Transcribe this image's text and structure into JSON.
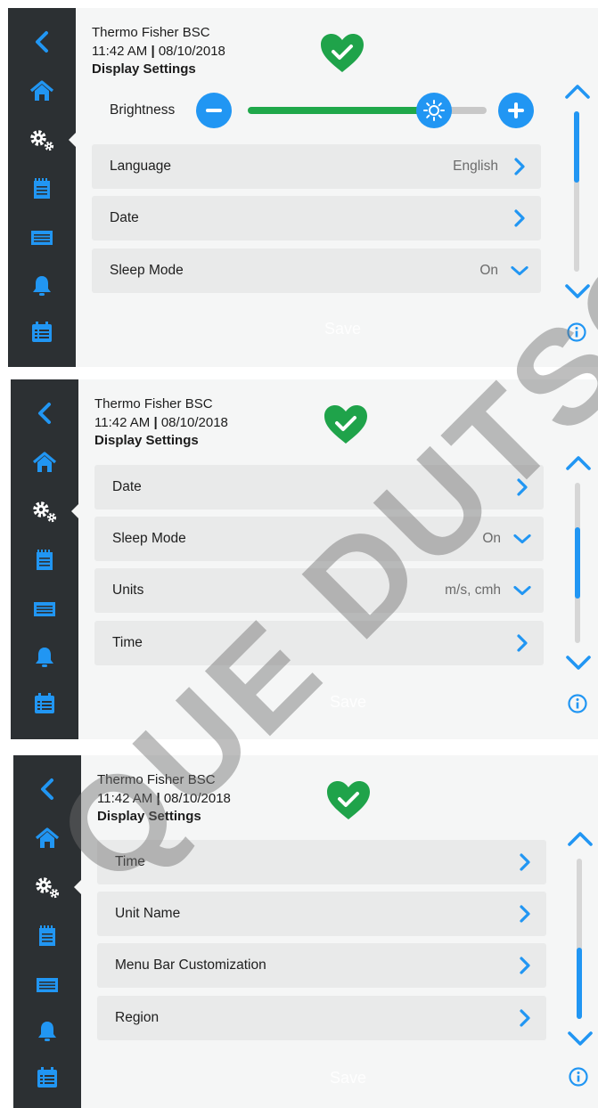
{
  "screens": [
    {
      "header": {
        "device": "Thermo Fisher BSC",
        "time": "11:42  AM",
        "separator": "|",
        "date": "08/10/2018",
        "page_title": "Display Settings"
      },
      "brightness": {
        "label": "Brightness",
        "level": 0.78
      },
      "rows": [
        {
          "label": "Language",
          "value": "English",
          "icon": "chevron-right-icon"
        },
        {
          "label": "Date",
          "value": "",
          "icon": "chevron-right-icon"
        },
        {
          "label": "Sleep Mode",
          "value": "On",
          "icon": "chevron-down-icon"
        }
      ],
      "save_label": "Save",
      "scroll_position": 0.0
    },
    {
      "header": {
        "device": "Thermo Fisher BSC",
        "time": "11:42  AM",
        "separator": "|",
        "date": "08/10/2018",
        "page_title": "Display Settings"
      },
      "rows": [
        {
          "label": "Date",
          "value": "",
          "icon": "chevron-right-icon"
        },
        {
          "label": "Sleep Mode",
          "value": "On",
          "icon": "chevron-down-icon"
        },
        {
          "label": "Units",
          "value": "m/s, cmh",
          "icon": "chevron-down-icon"
        },
        {
          "label": "Time",
          "value": "",
          "icon": "chevron-right-icon"
        }
      ],
      "save_label": "Save",
      "scroll_position": 0.5
    },
    {
      "header": {
        "device": "Thermo Fisher BSC",
        "time": "11:42  AM",
        "separator": "|",
        "date": "08/10/2018",
        "page_title": "Display Settings"
      },
      "rows": [
        {
          "label": "Time",
          "value": "",
          "icon": "chevron-right-icon"
        },
        {
          "label": "Unit Name",
          "value": "",
          "icon": "chevron-right-icon"
        },
        {
          "label": "Menu Bar Customization",
          "value": "",
          "icon": "chevron-right-icon"
        },
        {
          "label": "Region",
          "value": "",
          "icon": "chevron-right-icon"
        }
      ],
      "save_label": "Save",
      "scroll_position": 1.0
    }
  ],
  "sidebar_items": [
    "back-icon",
    "home-icon",
    "settings-icon",
    "clipboard-icon",
    "filter-icon",
    "bell-icon",
    "calendar-list-icon"
  ],
  "watermark": "QUE DUTSCHER",
  "colors": {
    "accent": "#2196f3",
    "sidebar": "#2c3033",
    "status_ok": "#1fa34a",
    "row_bg": "#e9eaea",
    "screen_bg": "#f5f6f6"
  }
}
